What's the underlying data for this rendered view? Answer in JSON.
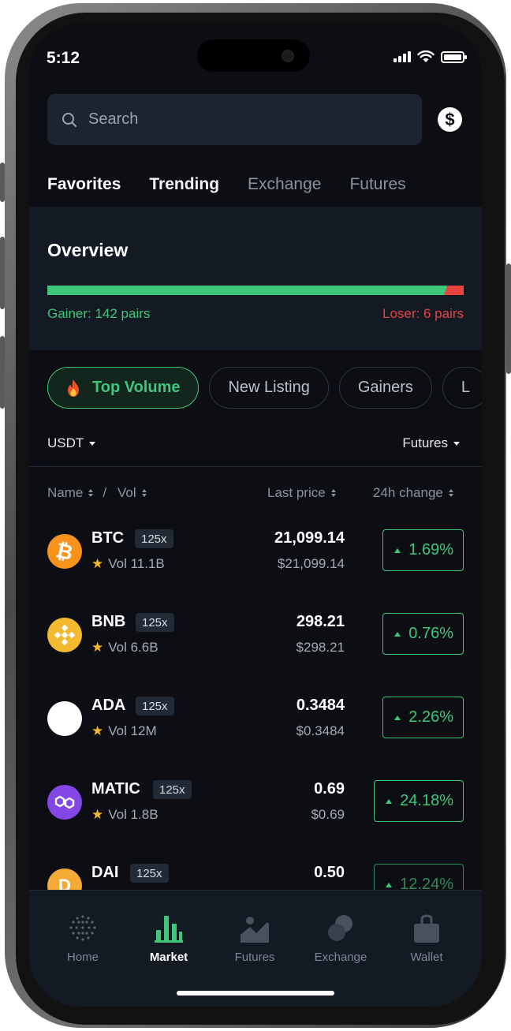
{
  "status_bar": {
    "time": "5:12"
  },
  "search": {
    "placeholder": "Search"
  },
  "tabs": [
    {
      "label": "Favorites"
    },
    {
      "label": "Trending"
    },
    {
      "label": "Exchange"
    },
    {
      "label": "Futures"
    }
  ],
  "overview": {
    "title": "Overview",
    "gainer_label": "Gainer: 142 pairs",
    "loser_label": "Loser: 6 pairs",
    "gainer_fraction": 0.96
  },
  "chips": [
    {
      "label": "Top Volume"
    },
    {
      "label": "New Listing"
    },
    {
      "label": "Gainers"
    },
    {
      "label": "L"
    }
  ],
  "filters": {
    "quote": "USDT",
    "market": "Futures"
  },
  "columns": {
    "name": "Name",
    "sep": "/",
    "vol": "Vol",
    "last_price": "Last price",
    "change": "24h change"
  },
  "coins": [
    {
      "symbol": "BTC",
      "leverage": "125x",
      "vol": "Vol 11.1B",
      "price": "21,099.14",
      "price_usd": "$21,099.14",
      "change": "1.69%"
    },
    {
      "symbol": "BNB",
      "leverage": "125x",
      "vol": "Vol 6.6B",
      "price": "298.21",
      "price_usd": "$298.21",
      "change": "0.76%"
    },
    {
      "symbol": "ADA",
      "leverage": "125x",
      "vol": "Vol 12M",
      "price": "0.3484",
      "price_usd": "$0.3484",
      "change": "2.26%"
    },
    {
      "symbol": "MATIC",
      "leverage": "125x",
      "vol": "Vol 1.8B",
      "price": "0.69",
      "price_usd": "$0.69",
      "change": "24.18%"
    },
    {
      "symbol": "DAI",
      "leverage": "125x",
      "vol": "",
      "price": "0.50",
      "price_usd": "",
      "change": "12.24%"
    }
  ],
  "bottom_nav": [
    {
      "label": "Home",
      "icon": "dots-globe-icon"
    },
    {
      "label": "Market",
      "icon": "bar-chart-icon"
    },
    {
      "label": "Futures",
      "icon": "mountain-chart-icon"
    },
    {
      "label": "Exchange",
      "icon": "exchange-circles-icon"
    },
    {
      "label": "Wallet",
      "icon": "wallet-bag-icon"
    }
  ],
  "colors": {
    "accent_green": "#3ec77a",
    "loss_red": "#e8433f",
    "background": "#0c0e14",
    "panel": "#141a24"
  }
}
